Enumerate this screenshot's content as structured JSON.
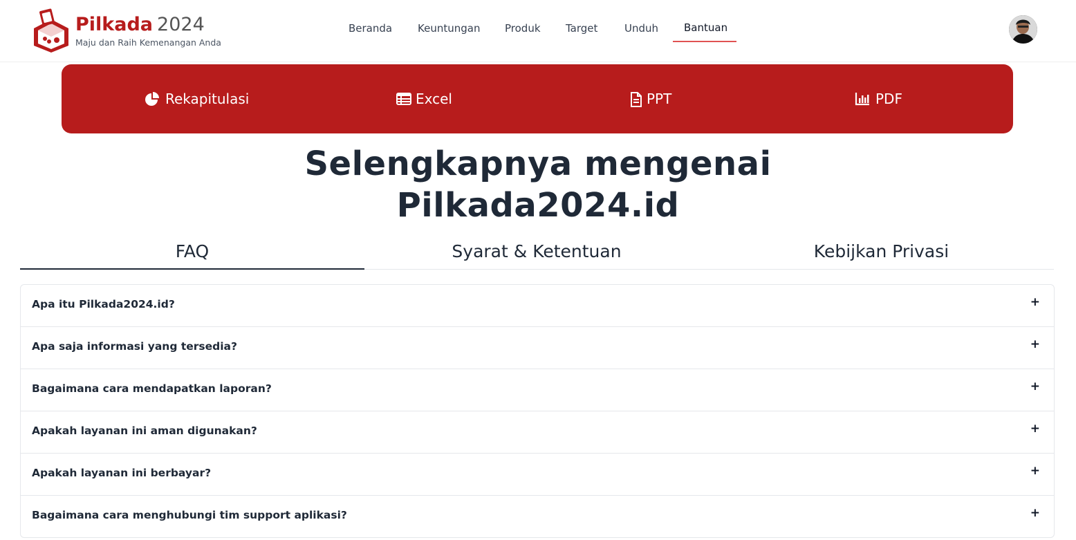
{
  "brand": {
    "name": "Pilkada",
    "year": "2024",
    "tagline": "Maju dan Raih Kemenangan Anda",
    "accent_color": "#b71c1c"
  },
  "nav": {
    "items": [
      {
        "label": "Beranda"
      },
      {
        "label": "Keuntungan"
      },
      {
        "label": "Produk"
      },
      {
        "label": "Target"
      },
      {
        "label": "Unduh"
      },
      {
        "label": "Bantuan",
        "active": true
      }
    ]
  },
  "banner": {
    "items": [
      {
        "label": "Rekapitulasi",
        "icon": "pie-chart-icon"
      },
      {
        "label": "Excel",
        "icon": "table-icon"
      },
      {
        "label": "PPT",
        "icon": "document-icon"
      },
      {
        "label": "PDF",
        "icon": "bar-chart-icon"
      }
    ],
    "background": "#b71c1c"
  },
  "heading": {
    "line1": "Selengkapnya mengenai",
    "line2": "Pilkada2024.id"
  },
  "tabs": {
    "items": [
      {
        "label": "FAQ",
        "active": true
      },
      {
        "label": "Syarat & Ketentuan"
      },
      {
        "label": "Kebijkan Privasi"
      }
    ]
  },
  "faq": {
    "items": [
      {
        "question": "Apa itu Pilkada2024.id?",
        "toggle": "+"
      },
      {
        "question": "Apa saja informasi yang tersedia?",
        "toggle": "+"
      },
      {
        "question": "Bagaimana cara mendapatkan laporan?",
        "toggle": "+"
      },
      {
        "question": "Apakah layanan ini aman digunakan?",
        "toggle": "+"
      },
      {
        "question": "Apakah layanan ini berbayar?",
        "toggle": "+"
      },
      {
        "question": "Bagaimana cara menghubungi tim support aplikasi?",
        "toggle": "+"
      }
    ]
  }
}
